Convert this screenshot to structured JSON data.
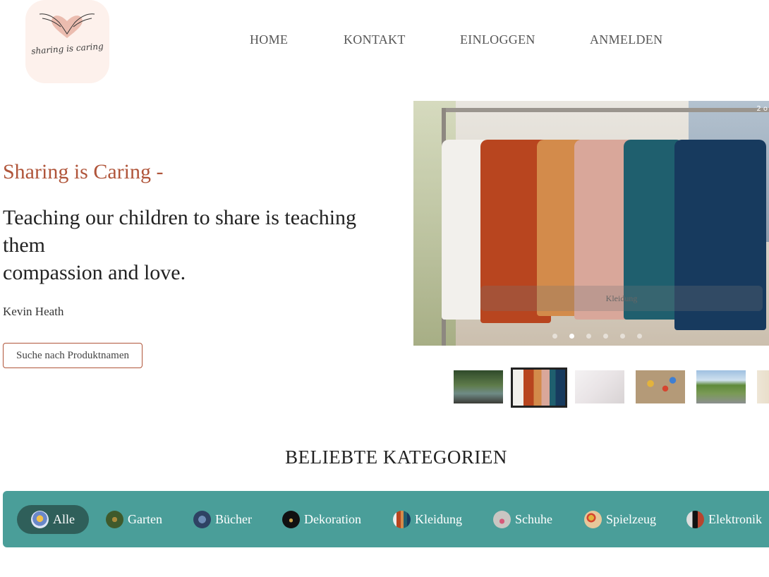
{
  "header": {
    "logo_text": "sharing is caring",
    "nav": [
      "HOME",
      "KONTAKT",
      "EINLOGGEN",
      "ANMELDEN"
    ]
  },
  "hero": {
    "subtitle": "Sharing is Caring -",
    "quote_line1": "Teaching our children to share is teaching them",
    "quote_line2": "compassion and love.",
    "author": "Kevin Heath",
    "search_button": "Suche nach Produktnamen"
  },
  "carousel": {
    "counter": "2 o",
    "caption": "Kleidung",
    "slide_count": 6,
    "active_slide": 2,
    "thumbnails": [
      "garden",
      "clothing",
      "books",
      "toys",
      "shoes",
      "electronics"
    ]
  },
  "categories": {
    "title": "BELIEBTE KATEGORIEN",
    "items": [
      "Alle",
      "Garten",
      "Bücher",
      "Dekoration",
      "Kleidung",
      "Schuhe",
      "Spielzeug",
      "Elektronik"
    ],
    "active": "Alle"
  },
  "colors": {
    "accent": "#b0553a",
    "category_bar": "#4a9e99",
    "category_active": "#2f5f5a",
    "logo_bg": "#fdf1ec"
  }
}
